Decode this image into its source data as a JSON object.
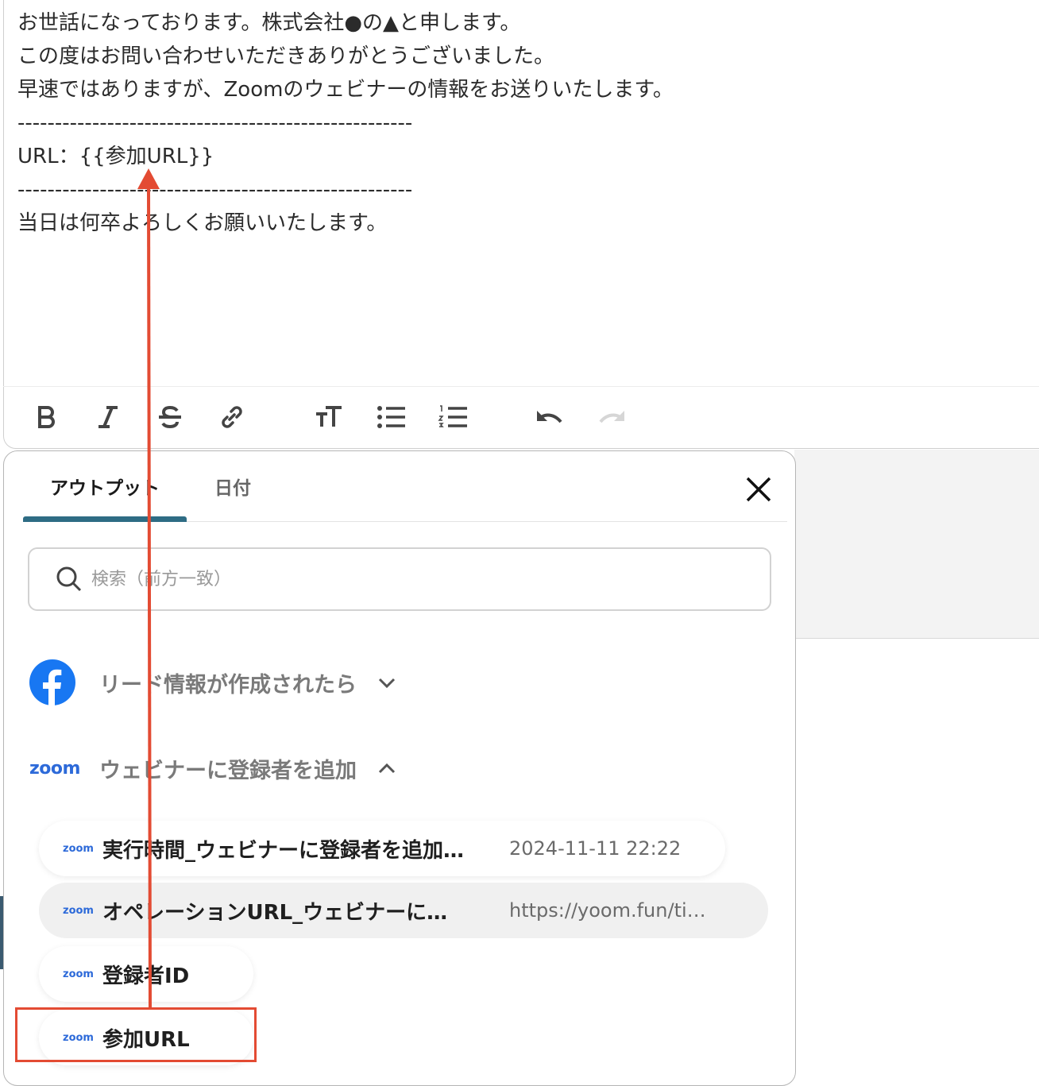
{
  "editor": {
    "lines": [
      "お世話になっております。株式会社●の▲と申します。",
      "この度はお問い合わせいただきありがとうございました。",
      "早速ではありますが、Zoomのウェビナーの情報をお送りいたします。",
      "-----------------------------------------------------",
      "URL：{{参加URL}}",
      "-----------------------------------------------------",
      "当日は何卒よろしくお願いいたします。"
    ],
    "toolbar": [
      "bold-icon",
      "italic-icon",
      "strikethrough-icon",
      "link-icon",
      "text-size-icon",
      "bullet-list-icon",
      "numbered-list-icon",
      "undo-icon",
      "redo-icon"
    ]
  },
  "popup": {
    "tabs": [
      {
        "label": "アウトプット",
        "active": true
      },
      {
        "label": "日付",
        "active": false
      }
    ],
    "search_placeholder": "検索（前方一致）",
    "groups": [
      {
        "icon": "facebook-icon",
        "title": "リード情報が作成されたら",
        "expanded": false
      },
      {
        "icon": "zoom-logo",
        "logo_text": "zoom",
        "title": "ウェビナーに登録者を追加",
        "expanded": true
      }
    ],
    "items": [
      {
        "logo_text": "zoom",
        "label": "実行時間_ウェビナーに登録者を追加…",
        "value": "2024-11-11 22:22"
      },
      {
        "logo_text": "zoom",
        "label": "オペレーションURL_ウェビナーに…",
        "value": "https://yoom.fun/ti…"
      },
      {
        "logo_text": "zoom",
        "label": "登録者ID",
        "value": ""
      },
      {
        "logo_text": "zoom",
        "label": "参加URL",
        "value": ""
      }
    ]
  },
  "colors": {
    "accent_tab": "#2e6c84",
    "zoom_blue": "#2d6ad9",
    "facebook_blue": "#1877f2",
    "annotation_red": "#e34b33"
  }
}
